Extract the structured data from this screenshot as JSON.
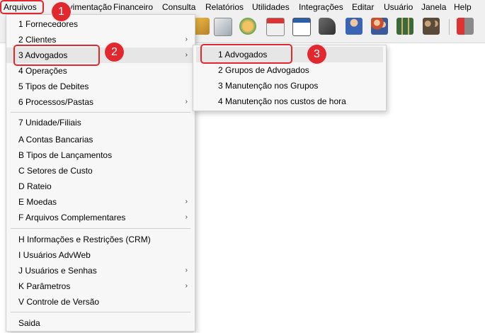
{
  "menubar": {
    "items": [
      "Arquivos",
      "Movimentação",
      "Financeiro",
      "Consulta",
      "Relatórios",
      "Utilidades",
      "Integrações",
      "Editar",
      "Usuário",
      "Janela",
      "Help"
    ]
  },
  "toolbar": {
    "icons": [
      "ruler-pencil-icon",
      "calendar-clock-icon",
      "folder-icon",
      "calendar-icon",
      "report-chart-icon",
      "send-arrow-icon",
      "user-icon",
      "users-icon",
      "grid-users-icon",
      "group-icon",
      "exit-icon"
    ]
  },
  "arquivos_menu": {
    "items": [
      {
        "label": "1 Fornecedores",
        "submenu": false
      },
      {
        "label": "2 Clientes",
        "submenu": true
      },
      {
        "label": "3 Advogados",
        "submenu": true
      },
      {
        "label": "4 Operações",
        "submenu": false
      },
      {
        "label": "5 Tipos de Debites",
        "submenu": false
      },
      {
        "label": "6 Processos/Pastas",
        "submenu": true
      },
      {
        "label": "7 Unidade/Filiais",
        "submenu": false
      },
      {
        "label": "A Contas Bancarias",
        "submenu": false
      },
      {
        "label": "B Tipos de Lançamentos",
        "submenu": false
      },
      {
        "label": "C Setores de Custo",
        "submenu": false
      },
      {
        "label": "D Rateio",
        "submenu": false
      },
      {
        "label": "E Moedas",
        "submenu": true
      },
      {
        "label": "F Arquivos Complementares",
        "submenu": true
      },
      {
        "label": "H Informações e Restrições (CRM)",
        "submenu": false
      },
      {
        "label": "I Usuários AdvWeb",
        "submenu": false
      },
      {
        "label": "J Usuários e Senhas",
        "submenu": true
      },
      {
        "label": "K Parâmetros",
        "submenu": true
      },
      {
        "label": "V Controle de Versão",
        "submenu": false
      },
      {
        "label": "Saida",
        "submenu": false
      }
    ],
    "arrow": "›"
  },
  "advogados_submenu": {
    "items": [
      "1 Advogados",
      "2 Grupos de Advogados",
      "3 Manutenção nos Grupos",
      "4 Manutenção nos custos de hora"
    ]
  },
  "annotations": {
    "badges": [
      "1",
      "2",
      "3"
    ],
    "color": "#e0282e"
  }
}
